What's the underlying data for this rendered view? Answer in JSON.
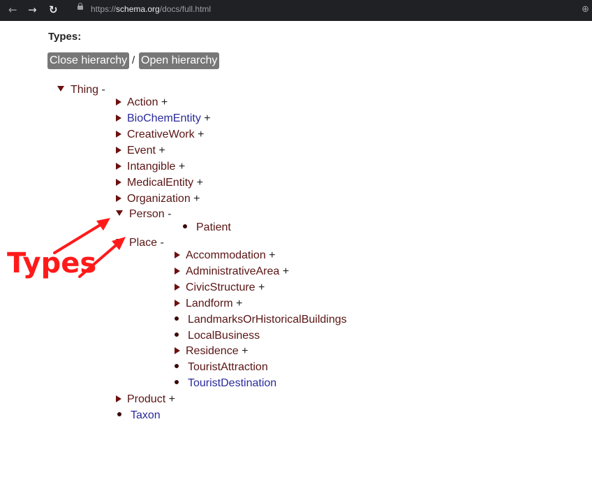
{
  "browser": {
    "back_icon": "arrow-left-icon",
    "forward_icon": "arrow-right-icon",
    "reload_icon": "reload-icon",
    "url_prefix": "https://",
    "url_host": "schema.org",
    "url_path": "/docs/full.html",
    "zoom_icon": "zoom-icon"
  },
  "page": {
    "heading": "Types:",
    "close_button": "Close hierarchy",
    "separator": "/",
    "open_button": "Open hierarchy"
  },
  "tree": {
    "thing": {
      "label": "Thing",
      "sign": "-"
    },
    "action": {
      "label": "Action",
      "sign": "+"
    },
    "biochem": {
      "label": "BioChemEntity",
      "sign": "+"
    },
    "creativework": {
      "label": "CreativeWork",
      "sign": "+"
    },
    "event": {
      "label": "Event",
      "sign": "+"
    },
    "intangible": {
      "label": "Intangible",
      "sign": "+"
    },
    "medicalentity": {
      "label": "MedicalEntity",
      "sign": "+"
    },
    "organization": {
      "label": "Organization",
      "sign": "+"
    },
    "person": {
      "label": "Person",
      "sign": "-"
    },
    "patient": {
      "label": "Patient"
    },
    "place": {
      "label": "Place",
      "sign": "-"
    },
    "accommodation": {
      "label": "Accommodation",
      "sign": "+"
    },
    "administrativearea": {
      "label": "AdministrativeArea",
      "sign": "+"
    },
    "civicstructure": {
      "label": "CivicStructure",
      "sign": "+"
    },
    "landform": {
      "label": "Landform",
      "sign": "+"
    },
    "landmarks": {
      "label": "LandmarksOrHistoricalBuildings"
    },
    "localbusiness": {
      "label": "LocalBusiness"
    },
    "residence": {
      "label": "Residence",
      "sign": "+"
    },
    "touristattraction": {
      "label": "TouristAttraction"
    },
    "touristdestination": {
      "label": "TouristDestination"
    },
    "product": {
      "label": "Product",
      "sign": "+"
    },
    "taxon": {
      "label": "Taxon"
    }
  },
  "annotation": {
    "text": "Types",
    "color": "#ff1a1a"
  },
  "colors": {
    "type_label": "#5a1414",
    "pending_label": "#2a2a9c",
    "button_bg": "#777777"
  }
}
